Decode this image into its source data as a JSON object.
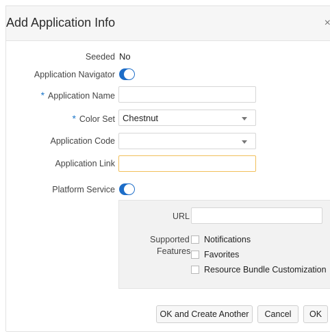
{
  "dialog": {
    "title": "Add Application Info",
    "close_glyph": "×"
  },
  "fields": {
    "seeded": {
      "label": "Seeded",
      "value": "No"
    },
    "app_navigator": {
      "label": "Application Navigator",
      "enabled": true
    },
    "app_name": {
      "label": "Application Name",
      "required_mark": "*",
      "value": ""
    },
    "color_set": {
      "label": "Color Set",
      "required_mark": "*",
      "value": "Chestnut"
    },
    "app_code": {
      "label": "Application Code",
      "value": ""
    },
    "app_link": {
      "label": "Application Link",
      "value": ""
    },
    "platform_service": {
      "label": "Platform Service",
      "enabled": true
    }
  },
  "platform_panel": {
    "url_label": "URL",
    "url_value": "",
    "supported_label_line1": "Supported",
    "supported_label_line2": "Features",
    "features": [
      {
        "label": "Notifications",
        "checked": false
      },
      {
        "label": "Favorites",
        "checked": false
      },
      {
        "label": "Resource Bundle Customization",
        "checked": false
      }
    ]
  },
  "buttons": {
    "ok_and_create_another": "OK and Create Another",
    "cancel": "Cancel",
    "ok": "OK"
  },
  "colors": {
    "accent": "#1d6dc8",
    "focus_border": "#f1bf5a",
    "required": "#1a75c9"
  }
}
